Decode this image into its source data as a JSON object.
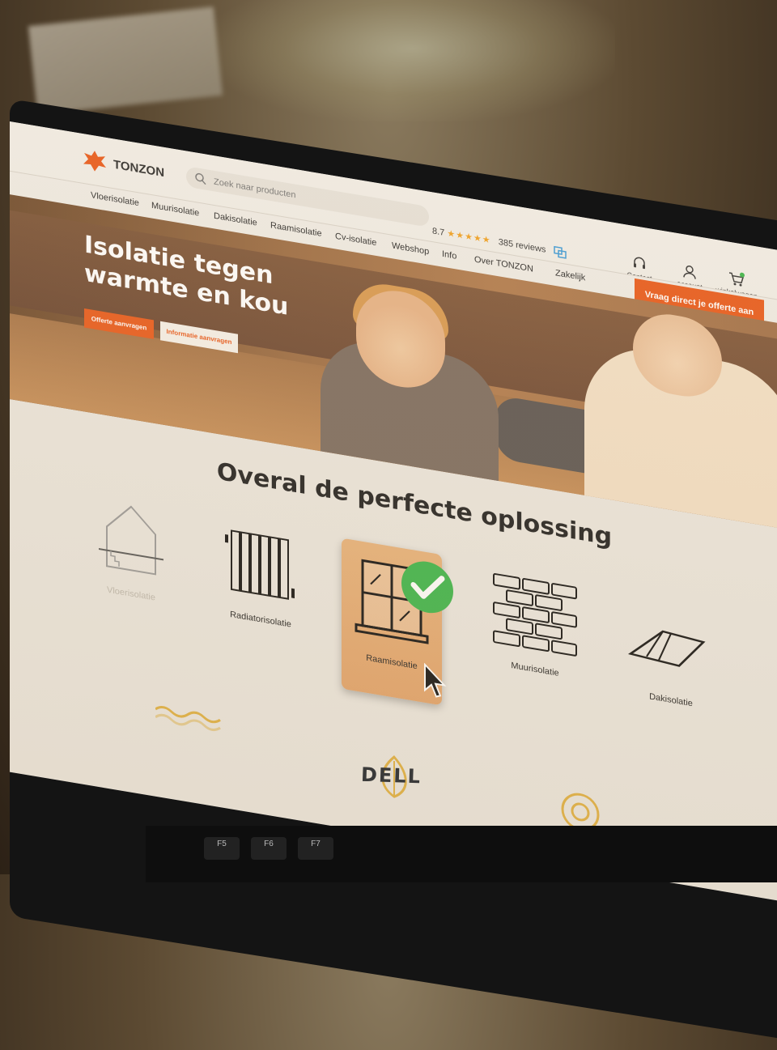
{
  "brand": {
    "name": "TONZON",
    "accent": "#e8591a"
  },
  "search": {
    "placeholder": "Zoek naar producten",
    "icon": "search-icon"
  },
  "rating": {
    "score": "8.7",
    "stars": "★★★★★",
    "reviews": "385 reviews"
  },
  "header_actions": [
    {
      "label": "Contact",
      "icon": "headset-icon"
    },
    {
      "label": "account",
      "icon": "user-icon"
    },
    {
      "label": "winkelwagen",
      "icon": "cart-icon"
    }
  ],
  "nav": {
    "items": [
      "Vloerisolatie",
      "Muurisolatie",
      "Dakisolatie",
      "Raamisolatie",
      "Cv-isolatie",
      "Webshop",
      "Info",
      "Over TONZON",
      "Zakelijk"
    ],
    "cta": "Vraag direct je offerte aan"
  },
  "hero": {
    "title_line1": "Isolatie tegen",
    "title_line2": "warmte en kou",
    "btn_primary": "Offerte aanvragen",
    "btn_secondary": "Informatie aanvragen"
  },
  "solutions": {
    "title": "Overal de perfecte oplossing",
    "items": [
      {
        "label": "Vloerisolatie",
        "icon": "house-floor-icon",
        "state": "faded"
      },
      {
        "label": "Radiatorisolatie",
        "icon": "radiator-icon",
        "state": "normal"
      },
      {
        "label": "Raamisolatie",
        "icon": "window-icon",
        "state": "active"
      },
      {
        "label": "Muurisolatie",
        "icon": "brick-wall-icon",
        "state": "normal"
      },
      {
        "label": "Dakisolatie",
        "icon": "roof-icon",
        "state": "normal"
      }
    ]
  },
  "device": {
    "brand": "DELL",
    "keys": [
      "F5",
      "F6",
      "F7"
    ]
  }
}
